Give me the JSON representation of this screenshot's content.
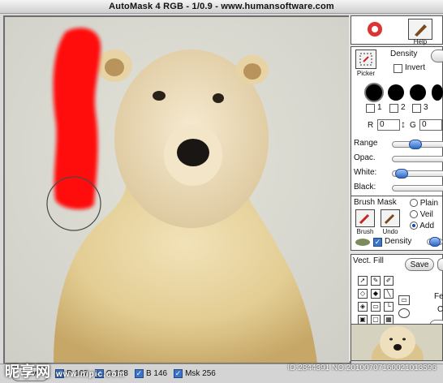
{
  "window": {
    "title": "AutoMask 4 RGB - 1/0.9 - www.humansoftware.com"
  },
  "toolbar": {
    "help_label": "Help"
  },
  "picker": {
    "label": "Picker",
    "density_label": "Density",
    "invert_label": "Invert"
  },
  "brush_sizes": {
    "labels": [
      "1",
      "2",
      "3"
    ]
  },
  "coords": {
    "r_label": "R",
    "r_value": "0",
    "g_label": "G",
    "g_value": "0"
  },
  "sliders": {
    "range": "Range",
    "opacity": "Opac.",
    "white": "White:",
    "black": "Black:"
  },
  "brush_mask": {
    "title": "Brush Mask",
    "brush_label": "Brush",
    "undo_label": "Undo",
    "modes": [
      "Plain",
      "Veil",
      "Add"
    ],
    "selected_mode": "Add",
    "density_label": "Density"
  },
  "vect_fill": {
    "title": "Vect. Fill",
    "save_label": "Save",
    "side_labels": [
      "Fe",
      "C"
    ]
  },
  "statusbar": {
    "view_label": "View",
    "channels": [
      {
        "label": "R 167"
      },
      {
        "label": "G 168"
      },
      {
        "label": "B 146"
      },
      {
        "label": "Msk 256"
      }
    ]
  },
  "watermark": {
    "left": "昵享网",
    "url": "www.nipic.com",
    "id": "ID:2844391 NO:20100707160021013596"
  }
}
